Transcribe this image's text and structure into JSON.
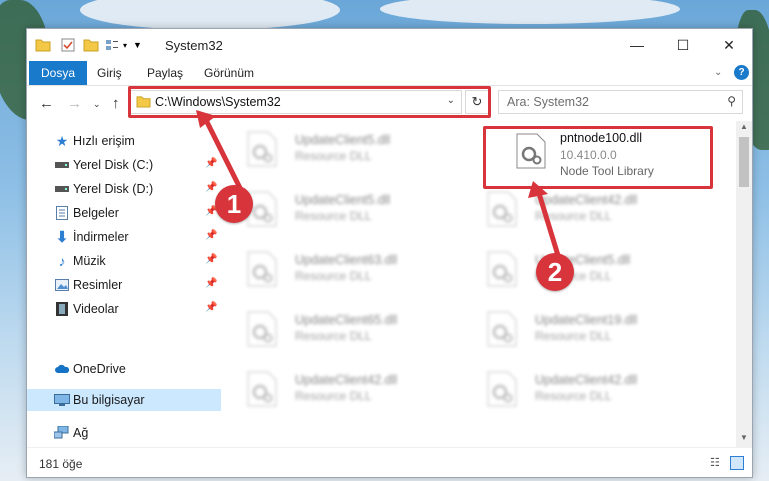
{
  "window": {
    "title": "System32",
    "controls": {
      "minimize": "—",
      "maximize": "☐",
      "close": "✕"
    }
  },
  "ribbon": {
    "tabs": [
      {
        "label": "Dosya",
        "active": true
      },
      {
        "label": "Giriş"
      },
      {
        "label": "Paylaş"
      },
      {
        "label": "Görünüm"
      }
    ]
  },
  "address": {
    "path": "C:\\Windows\\System32",
    "search_placeholder": "Ara: System32"
  },
  "sidebar": {
    "items": [
      {
        "label": "Hızlı erişim",
        "icon": "star-icon"
      },
      {
        "label": "Yerel Disk (C:)",
        "icon": "drive-icon",
        "pinned": true
      },
      {
        "label": "Yerel Disk (D:)",
        "icon": "drive-icon",
        "pinned": true
      },
      {
        "label": "Belgeler",
        "icon": "documents-icon",
        "pinned": true
      },
      {
        "label": "İndirmeler",
        "icon": "download-icon",
        "pinned": true
      },
      {
        "label": "Müzik",
        "icon": "music-icon",
        "pinned": true
      },
      {
        "label": "Resimler",
        "icon": "pictures-icon",
        "pinned": true
      },
      {
        "label": "Videolar",
        "icon": "videos-icon",
        "pinned": true
      },
      {
        "label": "OneDrive",
        "icon": "cloud-icon"
      },
      {
        "label": "Bu bilgisayar",
        "icon": "computer-icon",
        "selected": true
      },
      {
        "label": "Ağ",
        "icon": "network-icon"
      }
    ]
  },
  "files": [
    {
      "name": "UpdateClient5.dll",
      "type": "Resource DLL",
      "blurred": true
    },
    {
      "name": "pntnode100.dll",
      "version": "10.410.0.0",
      "type": "Node Tool Library",
      "blurred": false
    },
    {
      "name": "UpdateClient5.dll",
      "type": "Resource DLL",
      "blurred": true
    },
    {
      "name": "UpdateClient42.dll",
      "type": "Resource DLL",
      "blurred": true
    },
    {
      "name": "UpdateClient63.dll",
      "type": "Resource DLL",
      "blurred": true
    },
    {
      "name": "UpdateClient5.dll",
      "type": "Resource DLL",
      "blurred": true
    },
    {
      "name": "UpdateClient65.dll",
      "type": "Resource DLL",
      "blurred": true
    },
    {
      "name": "UpdateClient19.dll",
      "type": "Resource DLL",
      "blurred": true
    },
    {
      "name": "UpdateClient42.dll",
      "type": "Resource DLL",
      "blurred": true
    },
    {
      "name": "UpdateClient42.dll",
      "type": "Resource DLL",
      "blurred": true
    }
  ],
  "status": {
    "item_count": "181 öğe"
  },
  "callouts": {
    "first": "1",
    "second": "2"
  },
  "colors": {
    "highlight_red": "#d8343b",
    "accent_blue": "#1979ca",
    "selected_bg": "#cce8ff"
  }
}
